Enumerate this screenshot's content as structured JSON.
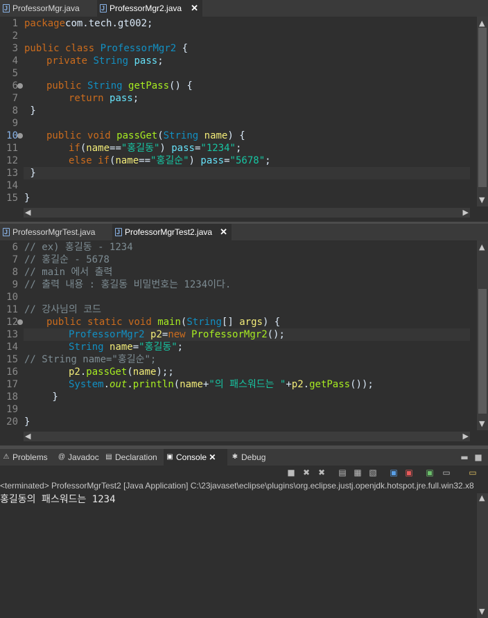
{
  "top_tabs": [
    {
      "label": "ProfessorMgr.java",
      "active": false
    },
    {
      "label": "ProfessorMgr2.java",
      "active": true
    }
  ],
  "editor1": {
    "lines": [
      {
        "n": "1",
        "segs": [
          [
            "kw",
            "package"
          ],
          [
            "",
            "com.tech.gt002;"
          ]
        ]
      },
      {
        "n": "2",
        "segs": []
      },
      {
        "n": "3",
        "segs": [
          [
            "kw",
            "public"
          ],
          [
            "",
            ""
          ],
          [
            "kw",
            "class"
          ],
          [
            "",
            ""
          ],
          [
            "ty",
            "ProfessorMgr2"
          ],
          [
            "",
            " {"
          ]
        ]
      },
      {
        "n": "4",
        "segs": [
          [
            "",
            " "
          ],
          [
            "kw",
            "private"
          ],
          [
            "",
            ""
          ],
          [
            "ty",
            "String"
          ],
          [
            "",
            ""
          ],
          [
            "id",
            "pass"
          ],
          [
            "",
            ";"
          ]
        ]
      },
      {
        "n": "5",
        "segs": []
      },
      {
        "n": "6",
        "segs": [
          [
            "",
            " "
          ],
          [
            "kw",
            "public"
          ],
          [
            "",
            ""
          ],
          [
            "ty",
            "String"
          ],
          [
            "",
            ""
          ],
          [
            "mt",
            "getPass"
          ],
          [
            "",
            "() {"
          ]
        ]
      },
      {
        "n": "7",
        "segs": [
          [
            "",
            " "
          ],
          [
            "kw",
            "return"
          ],
          [
            "",
            ""
          ],
          [
            "id",
            "pass"
          ],
          [
            "",
            ";"
          ]
        ]
      },
      {
        "n": "8",
        "segs": [
          [
            "",
            " }"
          ]
        ]
      },
      {
        "n": "9",
        "segs": []
      },
      {
        "n": "10",
        "segs": [
          [
            "",
            " "
          ],
          [
            "kw",
            "public"
          ],
          [
            "",
            ""
          ],
          [
            "kw",
            "void"
          ],
          [
            "",
            ""
          ],
          [
            "mt",
            "passGet"
          ],
          [
            "",
            "("
          ],
          [
            "ty",
            "String"
          ],
          [
            "",
            ""
          ],
          [
            "lv",
            "name"
          ],
          [
            "",
            ") {"
          ]
        ]
      },
      {
        "n": "11",
        "segs": [
          [
            "",
            " "
          ],
          [
            "kw",
            "if"
          ],
          [
            "",
            "("
          ],
          [
            "lv",
            "name"
          ],
          [
            "",
            "=="
          ],
          [
            "st",
            "\"홍길동\""
          ],
          [
            "",
            ") "
          ],
          [
            "id",
            "pass"
          ],
          [
            "",
            "="
          ],
          [
            "st",
            "\"1234\""
          ],
          [
            "",
            ";"
          ]
        ]
      },
      {
        "n": "12",
        "segs": [
          [
            "",
            " "
          ],
          [
            "kw",
            "else"
          ],
          [
            "",
            ""
          ],
          [
            "kw",
            "if"
          ],
          [
            "",
            "("
          ],
          [
            "lv",
            "name"
          ],
          [
            "",
            "=="
          ],
          [
            "st",
            "\"홍길순\""
          ],
          [
            "",
            ") "
          ],
          [
            "id",
            "pass"
          ],
          [
            "",
            "="
          ],
          [
            "st",
            "\"5678\""
          ],
          [
            "",
            ";"
          ]
        ]
      },
      {
        "n": "13",
        "segs": [
          [
            "",
            " }"
          ]
        ]
      },
      {
        "n": "14",
        "segs": []
      },
      {
        "n": "15",
        "segs": [
          [
            "",
            "}"
          ]
        ]
      }
    ]
  },
  "mid_tabs": [
    {
      "label": "ProfessorMgrTest.java",
      "active": false
    },
    {
      "label": "ProfessorMgrTest2.java",
      "active": true
    }
  ],
  "editor2": {
    "lines": [
      {
        "n": "6",
        "segs": [
          [
            "cm",
            "// ex) 홍길동 - 1234"
          ]
        ]
      },
      {
        "n": "7",
        "segs": [
          [
            "cm",
            "// 홍길순 - 5678"
          ]
        ]
      },
      {
        "n": "8",
        "segs": [
          [
            "cm",
            "// main 에서 출력"
          ]
        ]
      },
      {
        "n": "9",
        "segs": [
          [
            "cm",
            "// 출력 내용 : 홍길동 비밀번호는 1234이다."
          ]
        ]
      },
      {
        "n": "10",
        "segs": []
      },
      {
        "n": "11",
        "segs": [
          [
            "cm",
            "// 강사님의 코드"
          ]
        ]
      },
      {
        "n": "12",
        "segs": [
          [
            "",
            " "
          ],
          [
            "kw",
            "public"
          ],
          [
            "",
            ""
          ],
          [
            "kw",
            "static"
          ],
          [
            "",
            ""
          ],
          [
            "kw",
            "void"
          ],
          [
            "",
            ""
          ],
          [
            "mt",
            "main"
          ],
          [
            "",
            "("
          ],
          [
            "ty",
            "String"
          ],
          [
            "",
            "[] "
          ],
          [
            "lv",
            "args"
          ],
          [
            "",
            ") {"
          ]
        ]
      },
      {
        "n": "13",
        "segs": [
          [
            "",
            " "
          ],
          [
            "ty",
            "ProfessorMgr2"
          ],
          [
            "",
            ""
          ],
          [
            "lv",
            "p2"
          ],
          [
            "",
            "="
          ],
          [
            "kw",
            "new"
          ],
          [
            "",
            ""
          ],
          [
            "mt",
            "ProfessorMgr2"
          ],
          [
            "",
            "();"
          ]
        ]
      },
      {
        "n": "14",
        "segs": [
          [
            "",
            " "
          ],
          [
            "ty",
            "String"
          ],
          [
            "",
            ""
          ],
          [
            "lv",
            "name"
          ],
          [
            "",
            "="
          ],
          [
            "st",
            "\"홍길동\""
          ],
          [
            "",
            ";"
          ]
        ]
      },
      {
        "n": "15",
        "segs": [
          [
            "cm",
            "// String name=\"홍길순\";"
          ]
        ]
      },
      {
        "n": "16",
        "segs": [
          [
            "",
            " "
          ],
          [
            "lv",
            "p2"
          ],
          [
            "",
            "."
          ],
          [
            "mt",
            "passGet"
          ],
          [
            "",
            "("
          ],
          [
            "lv",
            "name"
          ],
          [
            "",
            ");;"
          ]
        ]
      },
      {
        "n": "17",
        "segs": [
          [
            "",
            " "
          ],
          [
            "ty",
            "System"
          ],
          [
            "",
            "."
          ],
          [
            "it",
            "out"
          ],
          [
            "",
            "."
          ],
          [
            "mt",
            "println"
          ],
          [
            "",
            "("
          ],
          [
            "lv",
            "name"
          ],
          [
            "",
            "+"
          ],
          [
            "st",
            "\"의 패스워드는 \""
          ],
          [
            "",
            "+"
          ],
          [
            "lv",
            "p2"
          ],
          [
            "",
            "."
          ],
          [
            "mt",
            "getPass"
          ],
          [
            "",
            "());"
          ]
        ]
      },
      {
        "n": "18",
        "segs": [
          [
            "",
            " }"
          ]
        ]
      },
      {
        "n": "19",
        "segs": []
      },
      {
        "n": "20",
        "segs": [
          [
            "",
            "}"
          ]
        ]
      }
    ]
  },
  "bottom_tabs": [
    {
      "label": "Problems",
      "icon": "problems-icon",
      "glyph": "⚠"
    },
    {
      "label": "Javadoc",
      "icon": "javadoc-icon",
      "glyph": "@"
    },
    {
      "label": "Declaration",
      "icon": "declaration-icon",
      "glyph": "▤"
    },
    {
      "label": "Console",
      "icon": "console-icon",
      "glyph": "▣"
    },
    {
      "label": "Debug",
      "icon": "debug-icon",
      "glyph": "✱"
    }
  ],
  "console": {
    "status": "<terminated> ProfessorMgrTest2 [Java Application] C:\\23javaset\\eclipse\\plugins\\org.eclipse.justj.openjdk.hotspot.jre.full.win32.x8",
    "output": "홍길동의 패스워드는 1234"
  }
}
